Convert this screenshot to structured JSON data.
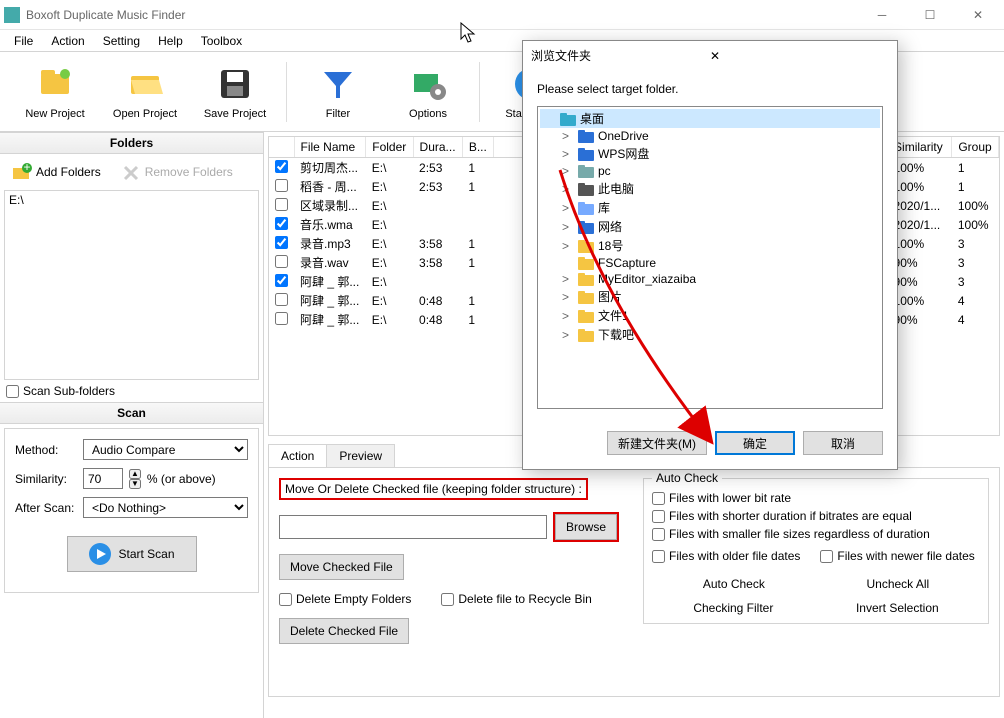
{
  "app": {
    "title": "Boxoft Duplicate Music Finder"
  },
  "menu": [
    "File",
    "Action",
    "Setting",
    "Help",
    "Toolbox"
  ],
  "toolbar": [
    {
      "id": "new-project",
      "label": "New Project"
    },
    {
      "id": "open-project",
      "label": "Open Project"
    },
    {
      "id": "save-project",
      "label": "Save Project"
    },
    {
      "sep": true
    },
    {
      "id": "filter",
      "label": "Filter"
    },
    {
      "id": "options",
      "label": "Options"
    },
    {
      "sep": true
    },
    {
      "id": "start-scan-tb",
      "label": "Start Scan"
    }
  ],
  "left": {
    "folders_header": "Folders",
    "add_folders": "Add Folders",
    "remove_folders": "Remove Folders",
    "folder_entries": [
      "E:\\"
    ],
    "scan_sub": "Scan Sub-folders",
    "scan_header": "Scan",
    "method_label": "Method:",
    "method_value": "Audio Compare",
    "similarity_label": "Similarity:",
    "similarity_value": "70",
    "similarity_suffix": "% (or above)",
    "after_scan_label": "After Scan:",
    "after_scan_value": "<Do Nothing>",
    "start_scan_btn": "Start Scan"
  },
  "table": {
    "columns": [
      "File Name",
      "Folder",
      "Dura...",
      "B...",
      "Similarity",
      "Group"
    ],
    "rows": [
      {
        "chk": true,
        "name": "剪切周杰...",
        "folder": "E:\\",
        "dur": "2:53",
        "b": "1",
        "sim": "100%",
        "grp": "1"
      },
      {
        "chk": false,
        "name": "稻香 - 周...",
        "folder": "E:\\",
        "dur": "2:53",
        "b": "1",
        "sim": "100%",
        "grp": "1"
      },
      {
        "chk": false,
        "name": "区域录制...",
        "folder": "E:\\",
        "dur": "",
        "b": "",
        "sim": "2020/1...",
        "grp": "100%"
      },
      {
        "chk": true,
        "name": "音乐.wma",
        "folder": "E:\\",
        "dur": "",
        "b": "",
        "sim": "2020/1...",
        "grp": "100%"
      },
      {
        "chk": true,
        "name": "录音.mp3",
        "folder": "E:\\",
        "dur": "3:58",
        "b": "1",
        "sim": "100%",
        "grp": "3"
      },
      {
        "chk": false,
        "name": "录音.wav",
        "folder": "E:\\",
        "dur": "3:58",
        "b": "1",
        "sim": "90%",
        "grp": "3"
      },
      {
        "chk": true,
        "name": "阿肆 _ 郭...",
        "folder": "E:\\",
        "dur": "",
        "b": "",
        "sim": "90%",
        "grp": "3"
      },
      {
        "chk": false,
        "name": "阿肆 _ 郭...",
        "folder": "E:\\",
        "dur": "0:48",
        "b": "1",
        "sim": "100%",
        "grp": "4"
      },
      {
        "chk": false,
        "name": "阿肆 _ 郭...",
        "folder": "E:\\",
        "dur": "0:48",
        "b": "1",
        "sim": "90%",
        "grp": "4"
      }
    ]
  },
  "tabs": {
    "action": "Action",
    "preview": "Preview"
  },
  "action_panel": {
    "title": "Move Or Delete Checked file (keeping folder structure) :",
    "browse": "Browse",
    "move_checked": "Move Checked File",
    "delete_empty": "Delete Empty Folders",
    "delete_recycle": "Delete file to Recycle Bin",
    "delete_checked": "Delete Checked File"
  },
  "auto_check": {
    "legend": "Auto Check",
    "opt1": "Files with lower bit rate",
    "opt2": "Files with shorter duration if bitrates are equal",
    "opt3": "Files with smaller file sizes regardless of duration",
    "opt4": "Files with older file dates",
    "opt5": "Files with newer file dates",
    "btn_auto": "Auto Check",
    "btn_uncheck": "Uncheck All",
    "btn_filter": "Checking Filter",
    "btn_invert": "Invert Selection"
  },
  "dialog": {
    "title": "浏览文件夹",
    "instruction": "Please select target folder.",
    "tree": [
      {
        "label": "桌面",
        "depth": 0,
        "sel": true,
        "icon": "desktop"
      },
      {
        "label": "OneDrive",
        "depth": 1,
        "exp": ">",
        "icon": "cloud"
      },
      {
        "label": "WPS网盘",
        "depth": 1,
        "exp": ">",
        "icon": "cloud"
      },
      {
        "label": "pc",
        "depth": 1,
        "exp": ">",
        "icon": "user"
      },
      {
        "label": "此电脑",
        "depth": 1,
        "exp": ">",
        "icon": "pc"
      },
      {
        "label": "库",
        "depth": 1,
        "exp": ">",
        "icon": "lib"
      },
      {
        "label": "网络",
        "depth": 1,
        "exp": ">",
        "icon": "net"
      },
      {
        "label": "18号",
        "depth": 1,
        "exp": ">",
        "icon": "folder"
      },
      {
        "label": "FSCapture",
        "depth": 1,
        "exp": "",
        "icon": "folder"
      },
      {
        "label": "MyEditor_xiazaiba",
        "depth": 1,
        "exp": ">",
        "icon": "folder"
      },
      {
        "label": "图片",
        "depth": 1,
        "exp": ">",
        "icon": "folder"
      },
      {
        "label": "文件1",
        "depth": 1,
        "exp": ">",
        "icon": "folder"
      },
      {
        "label": "下载吧",
        "depth": 1,
        "exp": ">",
        "icon": "folder"
      }
    ],
    "new_folder": "新建文件夹(M)",
    "ok": "确定",
    "cancel": "取消"
  }
}
